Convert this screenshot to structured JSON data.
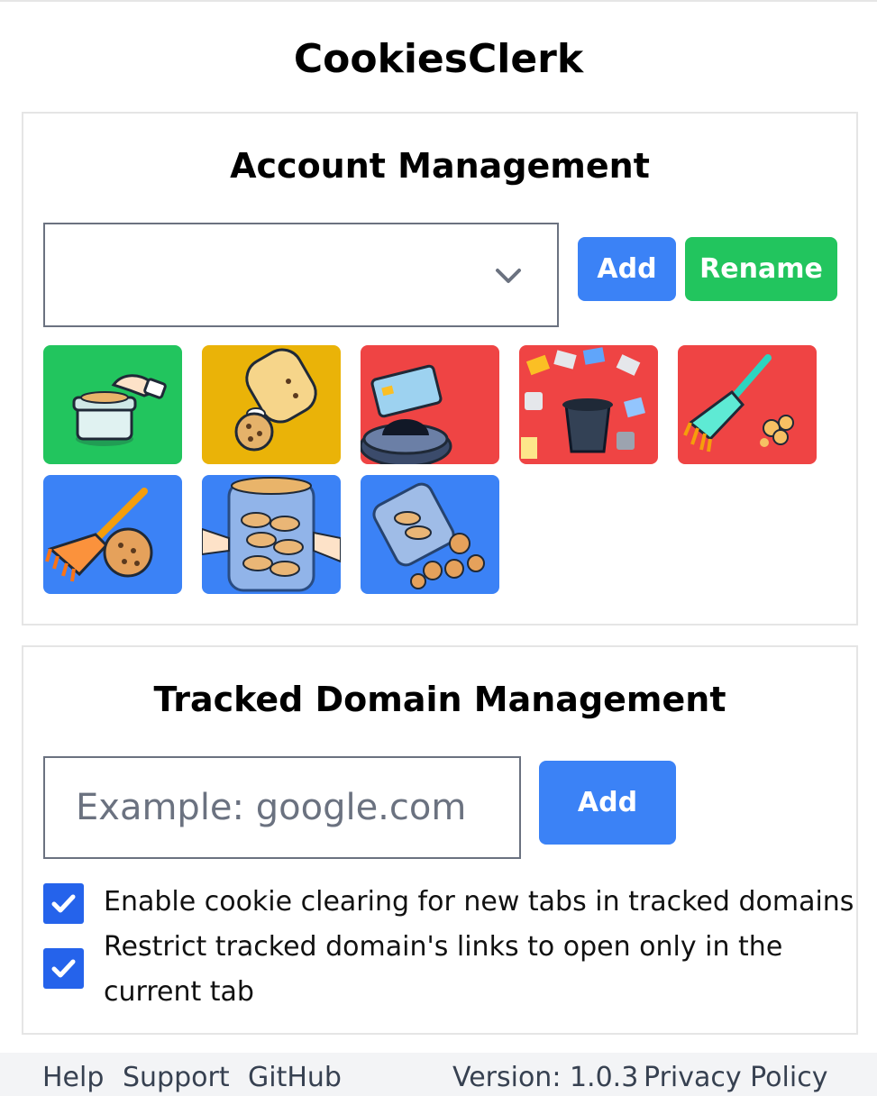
{
  "app": {
    "title": "CookiesClerk"
  },
  "account": {
    "title": "Account Management",
    "selected_account": "",
    "add_label": "Add",
    "rename_label": "Rename",
    "tiles": [
      {
        "name": "tile-cookie-jar-hand",
        "bg": "#22c55e"
      },
      {
        "name": "tile-spilled-jar",
        "bg": "#eab308"
      },
      {
        "name": "tile-card-trash",
        "bg": "#ef4444"
      },
      {
        "name": "tile-cards-into-trash",
        "bg": "#ef4444"
      },
      {
        "name": "tile-broom-crumbs",
        "bg": "#ef4444"
      },
      {
        "name": "tile-broom-cookie",
        "bg": "#3b82f6"
      },
      {
        "name": "tile-hands-cookie-jar",
        "bg": "#3b82f6"
      },
      {
        "name": "tile-jar-spilling-cookies",
        "bg": "#3b82f6"
      }
    ]
  },
  "domains": {
    "title": "Tracked Domain Management",
    "input_placeholder": "Example: google.com",
    "input_value": "",
    "add_label": "Add",
    "options": [
      {
        "label": "Enable cookie clearing for new tabs in tracked domains",
        "checked": true
      },
      {
        "label": "Restrict tracked domain's links to open only in the current tab",
        "checked": true
      }
    ]
  },
  "footer": {
    "help": "Help",
    "support": "Support",
    "github": "GitHub",
    "version": "Version: 1.0.3",
    "privacy": "Privacy Policy"
  },
  "colors": {
    "primary": "#3b82f6",
    "success": "#22c55e",
    "checkbox": "#2563eb"
  }
}
